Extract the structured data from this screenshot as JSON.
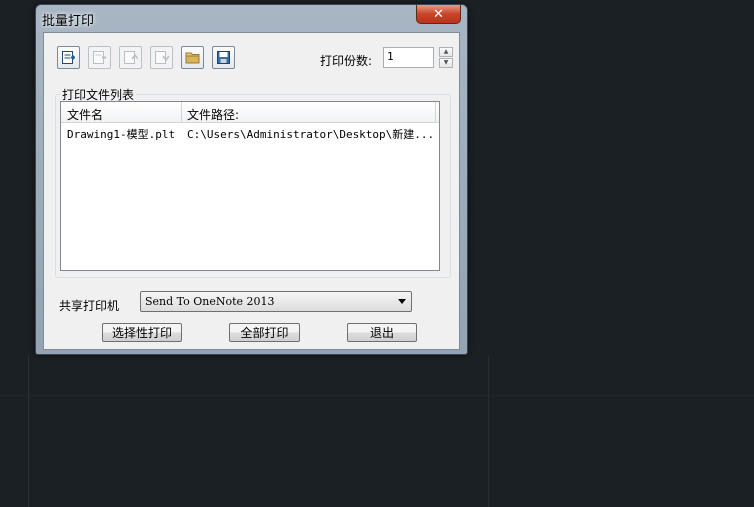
{
  "window": {
    "title": "批量打印",
    "close_glyph": "✕"
  },
  "toolbar": {
    "buttons": [
      {
        "icon": "add-file-icon",
        "enabled": true
      },
      {
        "icon": "remove-file-icon",
        "enabled": false
      },
      {
        "icon": "move-up-icon",
        "enabled": false
      },
      {
        "icon": "move-down-icon",
        "enabled": false
      },
      {
        "icon": "folder-icon",
        "enabled": true
      },
      {
        "icon": "save-icon",
        "enabled": true
      }
    ],
    "copies_label": "打印份数:",
    "copies_value": "1"
  },
  "file_list": {
    "group_title": "打印文件列表",
    "columns": [
      "文件名",
      "文件路径:"
    ],
    "rows": [
      {
        "name": "Drawing1-模型.plt",
        "path": "C:\\Users\\Administrator\\Desktop\\新建..."
      }
    ]
  },
  "printer": {
    "label": "共享打印机",
    "selected": "Send To OneNote 2013"
  },
  "actions": {
    "selective_print": "选择性打印",
    "print_all": "全部打印",
    "exit": "退出"
  }
}
